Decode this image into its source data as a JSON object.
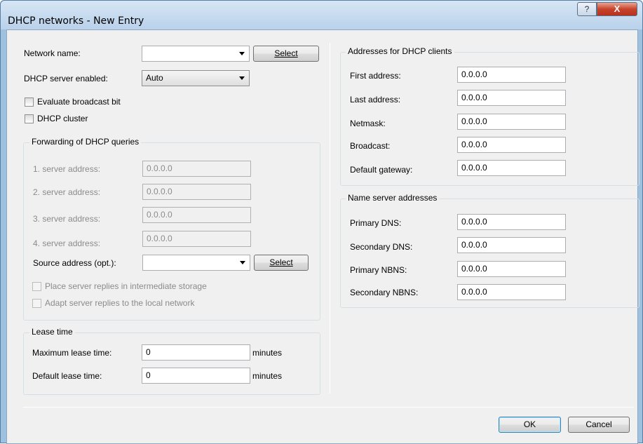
{
  "window": {
    "title": "DHCP networks - New Entry",
    "help_label": "?",
    "close_label": "X"
  },
  "network": {
    "name_label": "Network name:",
    "name_value": "",
    "select_label": "Select",
    "server_enabled_label": "DHCP server enabled:",
    "server_enabled_value": "Auto",
    "broadcast_bit_label": "Evaluate broadcast bit",
    "cluster_label": "DHCP cluster"
  },
  "forwarding": {
    "title": "Forwarding of DHCP queries",
    "servers": [
      {
        "label": "1. server address:",
        "value": "0.0.0.0"
      },
      {
        "label": "2. server address:",
        "value": "0.0.0.0"
      },
      {
        "label": "3. server address:",
        "value": "0.0.0.0"
      },
      {
        "label": "4. server address:",
        "value": "0.0.0.0"
      }
    ],
    "source_label": "Source address (opt.):",
    "source_value": "",
    "select_label": "Select",
    "intermediate_label": "Place server replies in intermediate storage",
    "adapt_label": "Adapt server replies to the local network"
  },
  "lease": {
    "title": "Lease time",
    "max_label": "Maximum lease time:",
    "max_value": "0",
    "max_unit": "minutes",
    "default_label": "Default lease time:",
    "default_value": "0",
    "default_unit": "minutes"
  },
  "clients": {
    "title": "Addresses for DHCP clients",
    "fields": [
      {
        "label": "First address:",
        "value": "0.0.0.0"
      },
      {
        "label": "Last address:",
        "value": "0.0.0.0"
      },
      {
        "label": "Netmask:",
        "value": "0.0.0.0"
      },
      {
        "label": "Broadcast:",
        "value": "0.0.0.0"
      },
      {
        "label": "Default gateway:",
        "value": "0.0.0.0"
      }
    ]
  },
  "nameservers": {
    "title": "Name server addresses",
    "fields": [
      {
        "label": "Primary DNS:",
        "value": "0.0.0.0"
      },
      {
        "label": "Secondary DNS:",
        "value": "0.0.0.0"
      },
      {
        "label": "Primary NBNS:",
        "value": "0.0.0.0"
      },
      {
        "label": "Secondary NBNS:",
        "value": "0.0.0.0"
      }
    ]
  },
  "footer": {
    "ok_label": "OK",
    "cancel_label": "Cancel"
  }
}
